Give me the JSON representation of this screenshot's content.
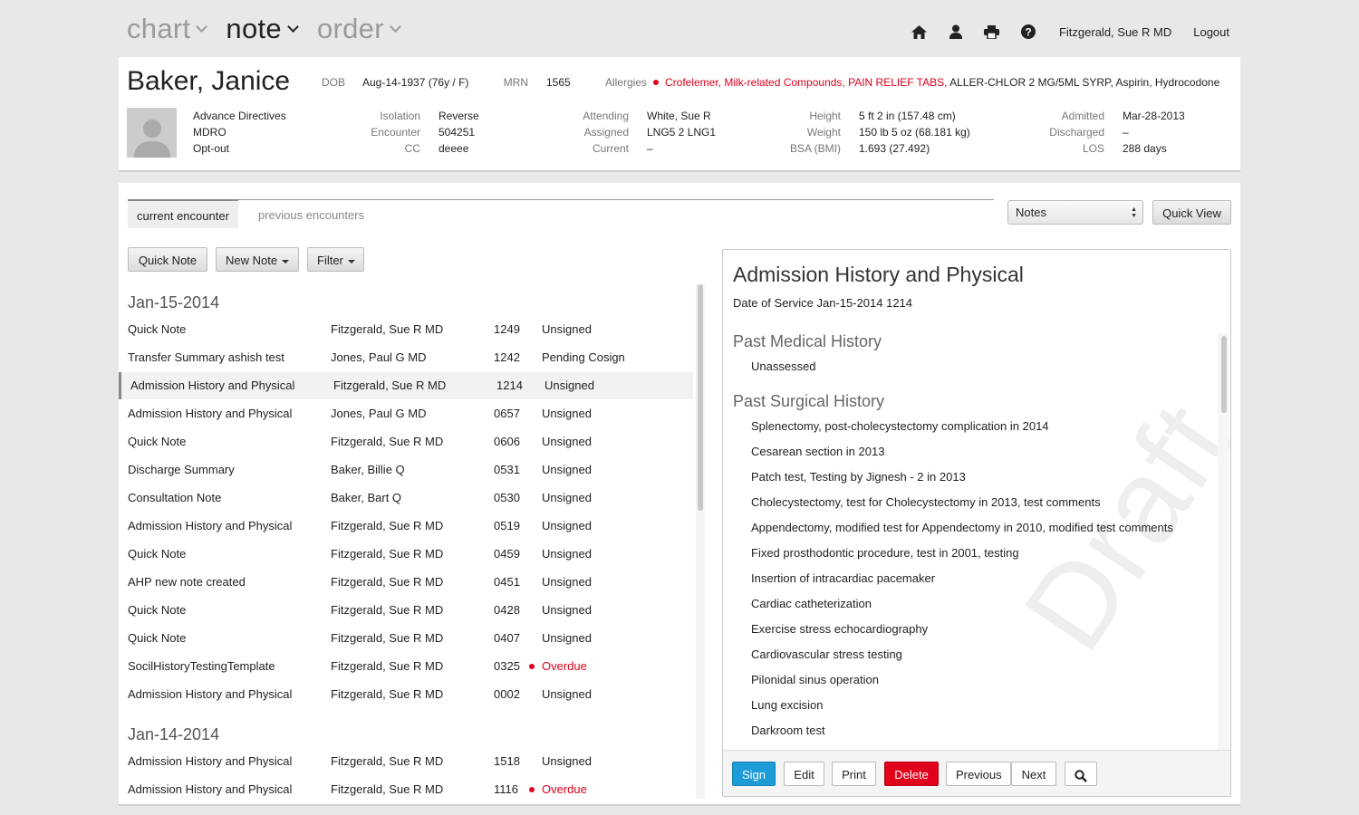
{
  "nav": {
    "items": [
      {
        "label": "chart",
        "active": false
      },
      {
        "label": "note",
        "active": true
      },
      {
        "label": "order",
        "active": false
      }
    ],
    "user_name": "Fitzgerald, Sue R MD",
    "logout_label": "Logout",
    "icons": [
      "home-icon",
      "user-icon",
      "print-icon",
      "help-icon"
    ]
  },
  "patient": {
    "name": "Baker, Janice",
    "dob_label": "DOB",
    "dob": "Aug-14-1937 (76y / F)",
    "mrn_label": "MRN",
    "mrn": "1565",
    "allergies_label": "Allergies",
    "allergies_severe": "Crofelemer, Milk-related Compounds, PAIN RELIEF TABS,",
    "allergies_other": "ALLER-CHLOR 2 MG/5ML SYRP, Aspirin, Hydrocodone",
    "flags": [
      "Advance Directives",
      "MDRO",
      "Opt-out"
    ],
    "isolation_label": "Isolation",
    "isolation": "Reverse",
    "encounter_label": "Encounter",
    "encounter": "504251",
    "cc_label": "CC",
    "cc": "deeee",
    "attending_label": "Attending",
    "attending": "White, Sue R",
    "assigned_label": "Assigned",
    "assigned": "LNG5 2 LNG1",
    "current_label": "Current",
    "current": "–",
    "height_label": "Height",
    "height": "5 ft 2 in (157.48 cm)",
    "weight_label": "Weight",
    "weight": "150 lb 5 oz (68.181 kg)",
    "bsa_label": "BSA (BMI)",
    "bsa": "1.693 (27.492)",
    "admitted_label": "Admitted",
    "admitted": "Mar-28-2013",
    "discharged_label": "Discharged",
    "discharged": "–",
    "los_label": "LOS",
    "los": "288 days"
  },
  "tabs": {
    "current": "current encounter",
    "previous": "previous encounters"
  },
  "view_select": {
    "value": "Notes",
    "quick_view_label": "Quick View"
  },
  "toolbar": {
    "quick_note": "Quick Note",
    "new_note": "New Note",
    "filter": "Filter"
  },
  "note_groups": [
    {
      "date": "Jan-15-2014",
      "rows": [
        {
          "title": "Quick Note",
          "author": "Fitzgerald, Sue R MD",
          "time": "1249",
          "status": "Unsigned",
          "overdue": false
        },
        {
          "title": "Transfer Summary ashish test",
          "author": "Jones, Paul G MD",
          "time": "1242",
          "status": "Pending Cosign",
          "overdue": false
        },
        {
          "title": "Admission History and Physical",
          "author": "Fitzgerald, Sue R MD",
          "time": "1214",
          "status": "Unsigned",
          "overdue": false,
          "selected": true
        },
        {
          "title": "Admission History and Physical",
          "author": "Jones, Paul G MD",
          "time": "0657",
          "status": "Unsigned",
          "overdue": false
        },
        {
          "title": "Quick Note",
          "author": "Fitzgerald, Sue R MD",
          "time": "0606",
          "status": "Unsigned",
          "overdue": false
        },
        {
          "title": "Discharge Summary",
          "author": "Baker, Billie Q",
          "time": "0531",
          "status": "Unsigned",
          "overdue": false
        },
        {
          "title": "Consultation Note",
          "author": "Baker, Bart Q",
          "time": "0530",
          "status": "Unsigned",
          "overdue": false
        },
        {
          "title": "Admission History and Physical",
          "author": "Fitzgerald, Sue R MD",
          "time": "0519",
          "status": "Unsigned",
          "overdue": false
        },
        {
          "title": "Quick Note",
          "author": "Fitzgerald, Sue R MD",
          "time": "0459",
          "status": "Unsigned",
          "overdue": false
        },
        {
          "title": "AHP new note created",
          "author": "Fitzgerald, Sue R MD",
          "time": "0451",
          "status": "Unsigned",
          "overdue": false
        },
        {
          "title": "Quick Note",
          "author": "Fitzgerald, Sue R MD",
          "time": "0428",
          "status": "Unsigned",
          "overdue": false
        },
        {
          "title": "Quick Note",
          "author": "Fitzgerald, Sue R MD",
          "time": "0407",
          "status": "Unsigned",
          "overdue": false
        },
        {
          "title": "SocilHistoryTestingTemplate",
          "author": "Fitzgerald, Sue R MD",
          "time": "0325",
          "status": "Overdue",
          "overdue": true
        },
        {
          "title": "Admission History and Physical",
          "author": "Fitzgerald, Sue R MD",
          "time": "0002",
          "status": "Unsigned",
          "overdue": false
        }
      ]
    },
    {
      "date": "Jan-14-2014",
      "rows": [
        {
          "title": "Admission History and Physical",
          "author": "Fitzgerald, Sue R MD",
          "time": "1518",
          "status": "Unsigned",
          "overdue": false
        },
        {
          "title": "Admission History and Physical",
          "author": "Fitzgerald, Sue R MD",
          "time": "1116",
          "status": "Overdue",
          "overdue": true
        }
      ]
    }
  ],
  "preview": {
    "title": "Admission History and Physical",
    "date_of_service": "Date of Service Jan-15-2014 1214",
    "watermark": "Draft",
    "sections": [
      {
        "heading": "Past Medical History",
        "items": [
          "Unassessed"
        ]
      },
      {
        "heading": "Past Surgical History",
        "items": [
          "Splenectomy, post-cholecystectomy complication in 2014",
          "Cesarean section in 2013",
          "Patch test, Testing by Jignesh - 2 in 2013",
          "Cholecystectomy, test for Cholecystectomy in 2013, test comments",
          "Appendectomy, modified test for Appendectomy in 2010, modified test comments",
          "Fixed prosthodontic procedure, test in 2001, testing",
          "Insertion of intracardiac pacemaker",
          "Cardiac catheterization",
          "Exercise stress echocardiography",
          "Cardiovascular stress testing",
          "Pilonidal sinus operation",
          "Lung excision",
          "Darkroom test"
        ]
      }
    ],
    "actions": {
      "sign": "Sign",
      "edit": "Edit",
      "print": "Print",
      "delete": "Delete",
      "previous": "Previous",
      "next": "Next"
    }
  },
  "colors": {
    "alert_red": "#e0001b",
    "sign_blue": "#1d9bd7",
    "background": "#e8e8e8"
  }
}
